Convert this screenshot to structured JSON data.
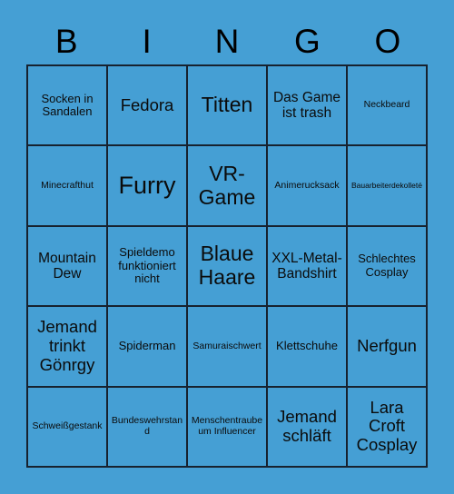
{
  "page": {
    "background_color": "#459FD4",
    "grid_line_color": "#17222f",
    "text_color": "#0b0b0b"
  },
  "header": {
    "letters": [
      "B",
      "I",
      "N",
      "G",
      "O"
    ]
  },
  "grid": {
    "columns": 5,
    "rows": 5,
    "cells": [
      [
        {
          "text": "Socken in Sandalen",
          "size": "m"
        },
        {
          "text": "Fedora",
          "size": "xl"
        },
        {
          "text": "Titten",
          "size": "xxl"
        },
        {
          "text": "Das Game ist trash",
          "size": "l"
        },
        {
          "text": "Neckbeard",
          "size": "s"
        }
      ],
      [
        {
          "text": "Minecrafthut",
          "size": "s"
        },
        {
          "text": "Furry",
          "size": "hg"
        },
        {
          "text": "VR-Game",
          "size": "xxl"
        },
        {
          "text": "Animerucksack",
          "size": "s"
        },
        {
          "text": "Bauarbeiterdekolleté",
          "size": "xs"
        }
      ],
      [
        {
          "text": "Mountain Dew",
          "size": "l"
        },
        {
          "text": "Spieldemo funktioniert nicht",
          "size": "m"
        },
        {
          "text": "Blaue Haare",
          "size": "xxl"
        },
        {
          "text": "XXL-Metal-Bandshirt",
          "size": "l"
        },
        {
          "text": "Schlechtes Cosplay",
          "size": "m"
        }
      ],
      [
        {
          "text": "Jemand trinkt Gönrgy",
          "size": "xl"
        },
        {
          "text": "Spiderman",
          "size": "m"
        },
        {
          "text": "Samuraischwert",
          "size": "s"
        },
        {
          "text": "Klettschuhe",
          "size": "m"
        },
        {
          "text": "Nerfgun",
          "size": "xl"
        }
      ],
      [
        {
          "text": "Schweißgestank",
          "size": "s"
        },
        {
          "text": "Bundeswehrstand",
          "size": "s"
        },
        {
          "text": "Menschentraube um Influencer",
          "size": "s"
        },
        {
          "text": "Jemand schläft",
          "size": "xl"
        },
        {
          "text": "Lara Croft Cosplay",
          "size": "xl"
        }
      ]
    ]
  }
}
